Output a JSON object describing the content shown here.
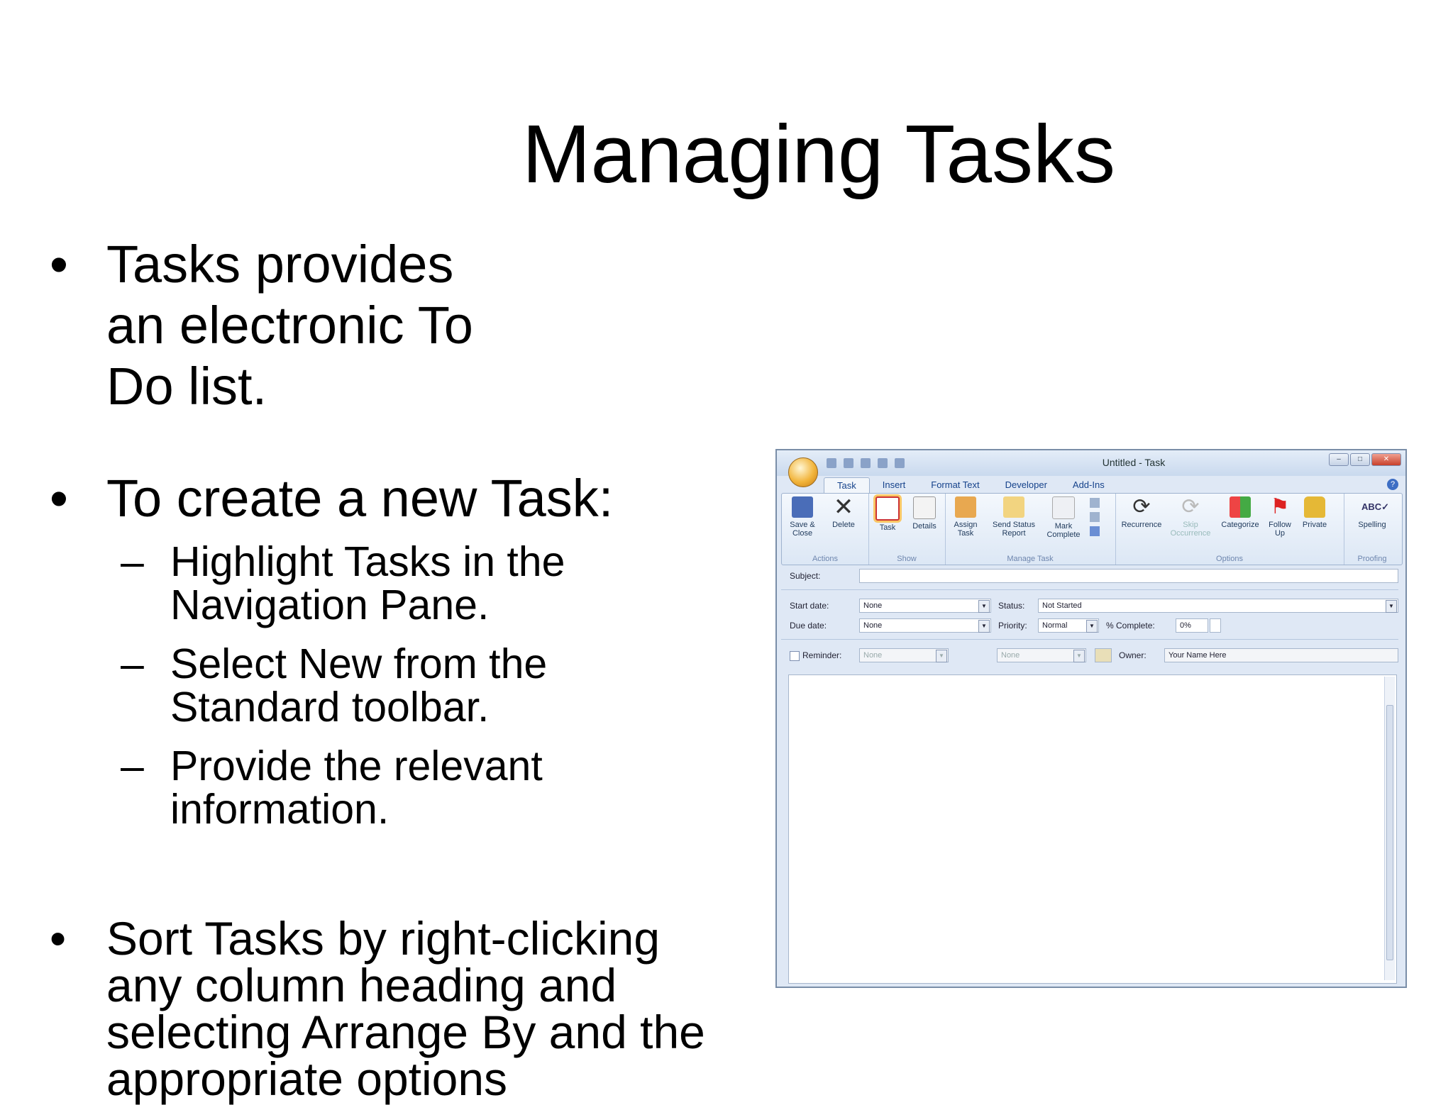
{
  "slide": {
    "title": "Managing Tasks",
    "bullets": [
      {
        "text": "Tasks provides an electronic To Do list."
      },
      {
        "text": "To create a new Task:",
        "subs": [
          "Highlight Tasks in the Navigation Pane.",
          "Select New from the Standard toolbar.",
          "Provide the relevant information."
        ]
      },
      {
        "text": "Sort Tasks by right-clicking any column heading and selecting Arrange By and the appropriate options"
      }
    ],
    "bullet_glyph": "•",
    "dash_glyph": "–"
  },
  "window": {
    "title": "Untitled - Task",
    "tabs": [
      "Task",
      "Insert",
      "Format Text",
      "Developer",
      "Add-Ins"
    ],
    "ribbon": {
      "groups": [
        "Actions",
        "Show",
        "Manage Task",
        "Options",
        "Proofing"
      ],
      "buttons": {
        "save_close": "Save & Close",
        "delete": "Delete",
        "task": "Task",
        "details": "Details",
        "assign_task": "Assign Task",
        "send_status": "Send Status Report",
        "mark_complete": "Mark Complete",
        "recurrence": "Recurrence",
        "skip_occurrence": "Skip Occurrence",
        "categorize": "Categorize",
        "follow_up": "Follow Up",
        "private": "Private",
        "spelling": "Spelling"
      }
    },
    "form": {
      "subject_label": "Subject:",
      "start_date_label": "Start date:",
      "start_date_value": "None",
      "due_date_label": "Due date:",
      "due_date_value": "None",
      "status_label": "Status:",
      "status_value": "Not Started",
      "priority_label": "Priority:",
      "priority_value": "Normal",
      "complete_label": "% Complete:",
      "complete_value": "0%",
      "reminder_label": "Reminder:",
      "reminder_value": "None",
      "reminder_time": "None",
      "owner_label": "Owner:",
      "owner_value": "Your Name Here"
    }
  }
}
